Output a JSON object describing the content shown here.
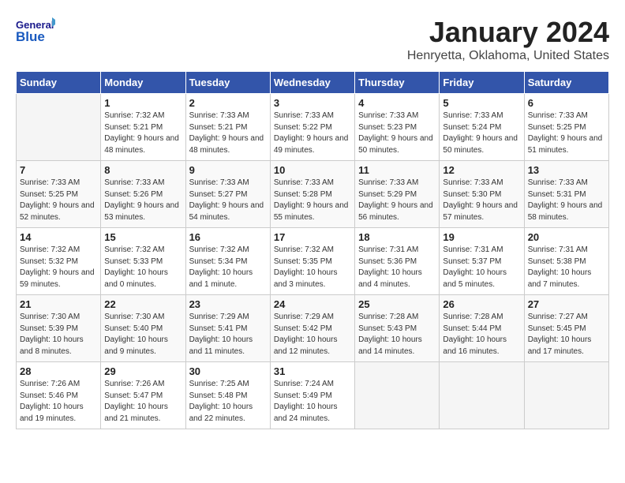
{
  "header": {
    "logo_general": "General",
    "logo_blue": "Blue",
    "month_title": "January 2024",
    "location": "Henryetta, Oklahoma, United States"
  },
  "days_of_week": [
    "Sunday",
    "Monday",
    "Tuesday",
    "Wednesday",
    "Thursday",
    "Friday",
    "Saturday"
  ],
  "weeks": [
    [
      {
        "num": "",
        "sunrise": "",
        "sunset": "",
        "daylight": "",
        "empty": true
      },
      {
        "num": "1",
        "sunrise": "Sunrise: 7:32 AM",
        "sunset": "Sunset: 5:21 PM",
        "daylight": "Daylight: 9 hours and 48 minutes."
      },
      {
        "num": "2",
        "sunrise": "Sunrise: 7:33 AM",
        "sunset": "Sunset: 5:21 PM",
        "daylight": "Daylight: 9 hours and 48 minutes."
      },
      {
        "num": "3",
        "sunrise": "Sunrise: 7:33 AM",
        "sunset": "Sunset: 5:22 PM",
        "daylight": "Daylight: 9 hours and 49 minutes."
      },
      {
        "num": "4",
        "sunrise": "Sunrise: 7:33 AM",
        "sunset": "Sunset: 5:23 PM",
        "daylight": "Daylight: 9 hours and 50 minutes."
      },
      {
        "num": "5",
        "sunrise": "Sunrise: 7:33 AM",
        "sunset": "Sunset: 5:24 PM",
        "daylight": "Daylight: 9 hours and 50 minutes."
      },
      {
        "num": "6",
        "sunrise": "Sunrise: 7:33 AM",
        "sunset": "Sunset: 5:25 PM",
        "daylight": "Daylight: 9 hours and 51 minutes."
      }
    ],
    [
      {
        "num": "7",
        "sunrise": "Sunrise: 7:33 AM",
        "sunset": "Sunset: 5:25 PM",
        "daylight": "Daylight: 9 hours and 52 minutes."
      },
      {
        "num": "8",
        "sunrise": "Sunrise: 7:33 AM",
        "sunset": "Sunset: 5:26 PM",
        "daylight": "Daylight: 9 hours and 53 minutes."
      },
      {
        "num": "9",
        "sunrise": "Sunrise: 7:33 AM",
        "sunset": "Sunset: 5:27 PM",
        "daylight": "Daylight: 9 hours and 54 minutes."
      },
      {
        "num": "10",
        "sunrise": "Sunrise: 7:33 AM",
        "sunset": "Sunset: 5:28 PM",
        "daylight": "Daylight: 9 hours and 55 minutes."
      },
      {
        "num": "11",
        "sunrise": "Sunrise: 7:33 AM",
        "sunset": "Sunset: 5:29 PM",
        "daylight": "Daylight: 9 hours and 56 minutes."
      },
      {
        "num": "12",
        "sunrise": "Sunrise: 7:33 AM",
        "sunset": "Sunset: 5:30 PM",
        "daylight": "Daylight: 9 hours and 57 minutes."
      },
      {
        "num": "13",
        "sunrise": "Sunrise: 7:33 AM",
        "sunset": "Sunset: 5:31 PM",
        "daylight": "Daylight: 9 hours and 58 minutes."
      }
    ],
    [
      {
        "num": "14",
        "sunrise": "Sunrise: 7:32 AM",
        "sunset": "Sunset: 5:32 PM",
        "daylight": "Daylight: 9 hours and 59 minutes."
      },
      {
        "num": "15",
        "sunrise": "Sunrise: 7:32 AM",
        "sunset": "Sunset: 5:33 PM",
        "daylight": "Daylight: 10 hours and 0 minutes."
      },
      {
        "num": "16",
        "sunrise": "Sunrise: 7:32 AM",
        "sunset": "Sunset: 5:34 PM",
        "daylight": "Daylight: 10 hours and 1 minute."
      },
      {
        "num": "17",
        "sunrise": "Sunrise: 7:32 AM",
        "sunset": "Sunset: 5:35 PM",
        "daylight": "Daylight: 10 hours and 3 minutes."
      },
      {
        "num": "18",
        "sunrise": "Sunrise: 7:31 AM",
        "sunset": "Sunset: 5:36 PM",
        "daylight": "Daylight: 10 hours and 4 minutes."
      },
      {
        "num": "19",
        "sunrise": "Sunrise: 7:31 AM",
        "sunset": "Sunset: 5:37 PM",
        "daylight": "Daylight: 10 hours and 5 minutes."
      },
      {
        "num": "20",
        "sunrise": "Sunrise: 7:31 AM",
        "sunset": "Sunset: 5:38 PM",
        "daylight": "Daylight: 10 hours and 7 minutes."
      }
    ],
    [
      {
        "num": "21",
        "sunrise": "Sunrise: 7:30 AM",
        "sunset": "Sunset: 5:39 PM",
        "daylight": "Daylight: 10 hours and 8 minutes."
      },
      {
        "num": "22",
        "sunrise": "Sunrise: 7:30 AM",
        "sunset": "Sunset: 5:40 PM",
        "daylight": "Daylight: 10 hours and 9 minutes."
      },
      {
        "num": "23",
        "sunrise": "Sunrise: 7:29 AM",
        "sunset": "Sunset: 5:41 PM",
        "daylight": "Daylight: 10 hours and 11 minutes."
      },
      {
        "num": "24",
        "sunrise": "Sunrise: 7:29 AM",
        "sunset": "Sunset: 5:42 PM",
        "daylight": "Daylight: 10 hours and 12 minutes."
      },
      {
        "num": "25",
        "sunrise": "Sunrise: 7:28 AM",
        "sunset": "Sunset: 5:43 PM",
        "daylight": "Daylight: 10 hours and 14 minutes."
      },
      {
        "num": "26",
        "sunrise": "Sunrise: 7:28 AM",
        "sunset": "Sunset: 5:44 PM",
        "daylight": "Daylight: 10 hours and 16 minutes."
      },
      {
        "num": "27",
        "sunrise": "Sunrise: 7:27 AM",
        "sunset": "Sunset: 5:45 PM",
        "daylight": "Daylight: 10 hours and 17 minutes."
      }
    ],
    [
      {
        "num": "28",
        "sunrise": "Sunrise: 7:26 AM",
        "sunset": "Sunset: 5:46 PM",
        "daylight": "Daylight: 10 hours and 19 minutes."
      },
      {
        "num": "29",
        "sunrise": "Sunrise: 7:26 AM",
        "sunset": "Sunset: 5:47 PM",
        "daylight": "Daylight: 10 hours and 21 minutes."
      },
      {
        "num": "30",
        "sunrise": "Sunrise: 7:25 AM",
        "sunset": "Sunset: 5:48 PM",
        "daylight": "Daylight: 10 hours and 22 minutes."
      },
      {
        "num": "31",
        "sunrise": "Sunrise: 7:24 AM",
        "sunset": "Sunset: 5:49 PM",
        "daylight": "Daylight: 10 hours and 24 minutes."
      },
      {
        "num": "",
        "sunrise": "",
        "sunset": "",
        "daylight": "",
        "empty": true
      },
      {
        "num": "",
        "sunrise": "",
        "sunset": "",
        "daylight": "",
        "empty": true
      },
      {
        "num": "",
        "sunrise": "",
        "sunset": "",
        "daylight": "",
        "empty": true
      }
    ]
  ]
}
